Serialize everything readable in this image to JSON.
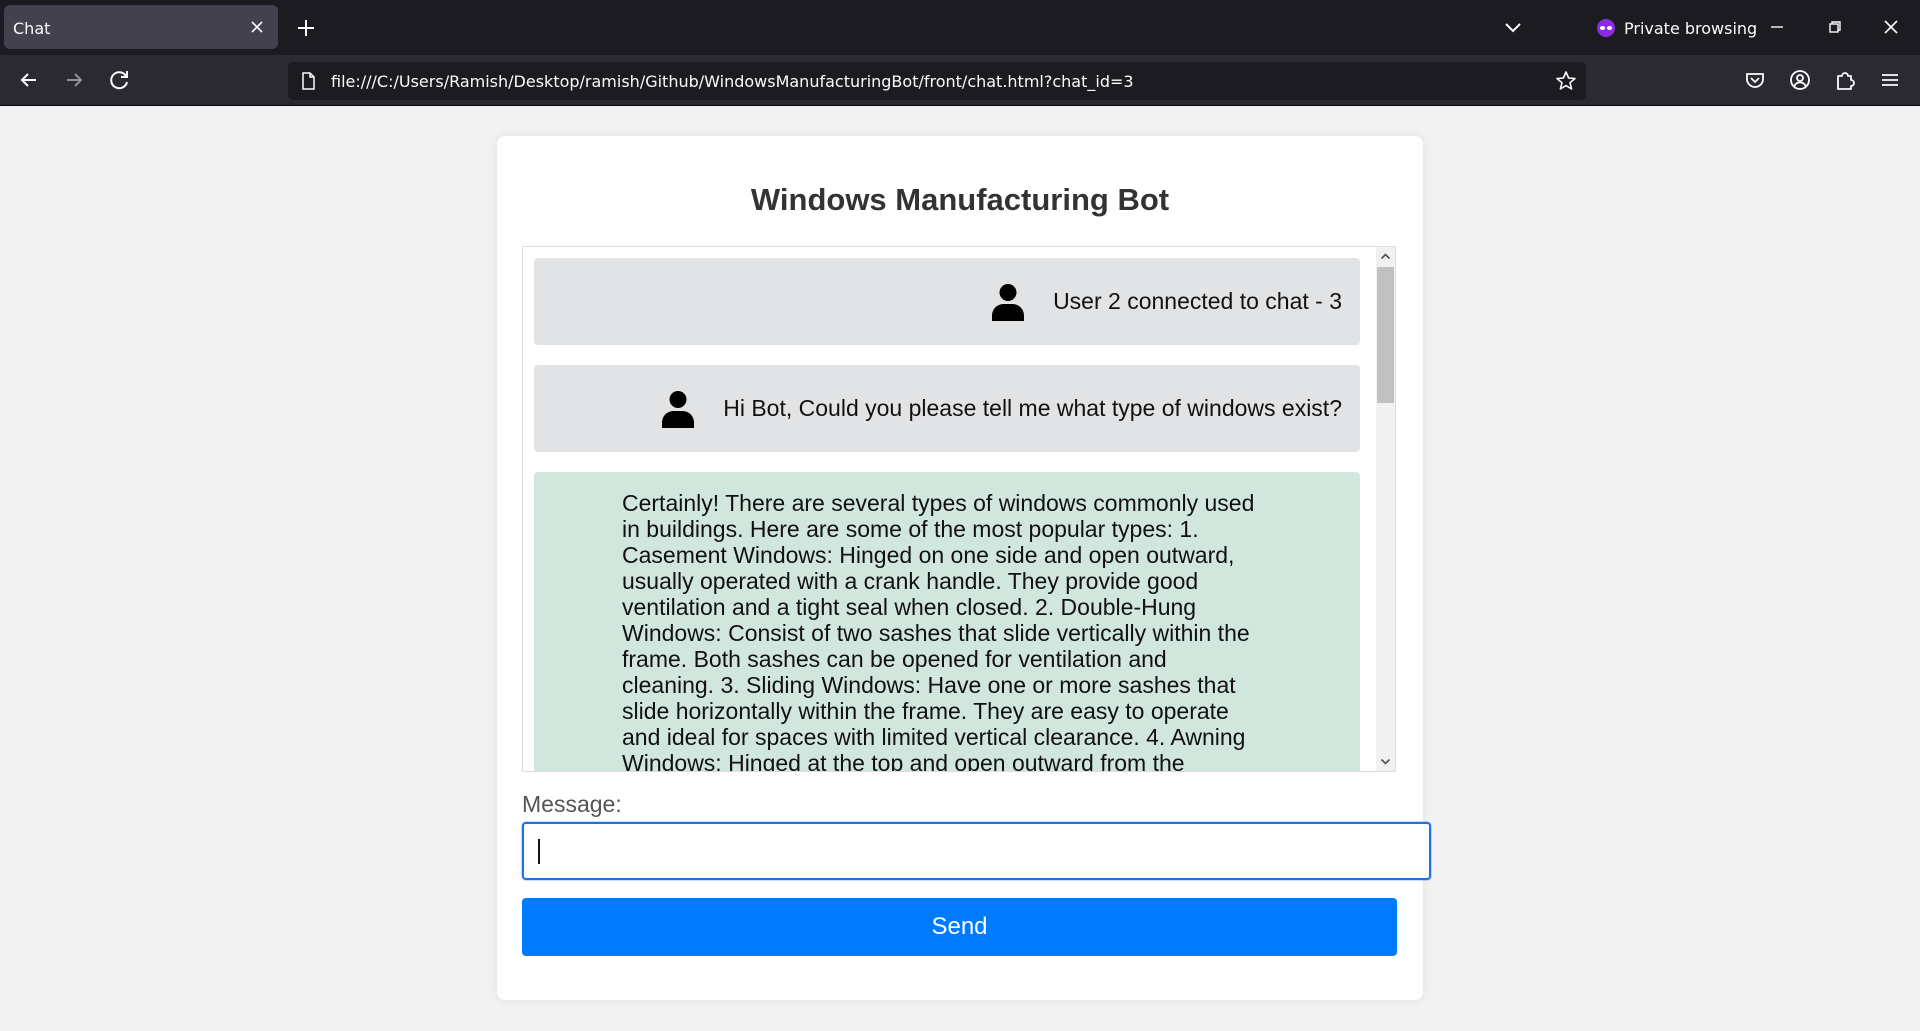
{
  "browser": {
    "tab_title": "Chat",
    "private_label": "Private browsing",
    "url": "file:///C:/Users/Ramish/Desktop/ramish/Github/WindowsManufacturingBot/front/chat.html?chat_id=3",
    "icons": [
      "close-icon",
      "plus-icon",
      "chevron-down-icon",
      "private-mask-icon",
      "minimize-icon",
      "restore-icon",
      "close-window-icon",
      "back-icon",
      "forward-icon",
      "reload-icon",
      "page-icon",
      "star-icon",
      "pocket-icon",
      "account-icon",
      "extensions-icon",
      "menu-icon"
    ]
  },
  "app": {
    "title": "Windows Manufacturing Bot",
    "messages": [
      {
        "role": "system",
        "text": "User 2 connected to chat - 3"
      },
      {
        "role": "user",
        "text": "Hi Bot, Could you please tell me what type of windows exist?"
      },
      {
        "role": "bot",
        "text": "Certainly! There are several types of windows commonly used in buildings. Here are some of the most popular types: 1. Casement Windows: Hinged on one side and open outward, usually operated with a crank handle. They provide good ventilation and a tight seal when closed. 2. Double-Hung Windows: Consist of two sashes that slide vertically within the frame. Both sashes can be opened for ventilation and cleaning. 3. Sliding Windows: Have one or more sashes that slide horizontally within the frame. They are easy to operate and ideal for spaces with limited vertical clearance. 4. Awning Windows: Hinged at the top and open outward from the"
      }
    ],
    "message_label": "Message:",
    "message_value": "",
    "send_label": "Send"
  },
  "colors": {
    "accent": "#007bff",
    "bot_bubble": "#d1e7dd",
    "user_bubble": "#e2e3e5",
    "focus_border": "#1a73e8"
  }
}
